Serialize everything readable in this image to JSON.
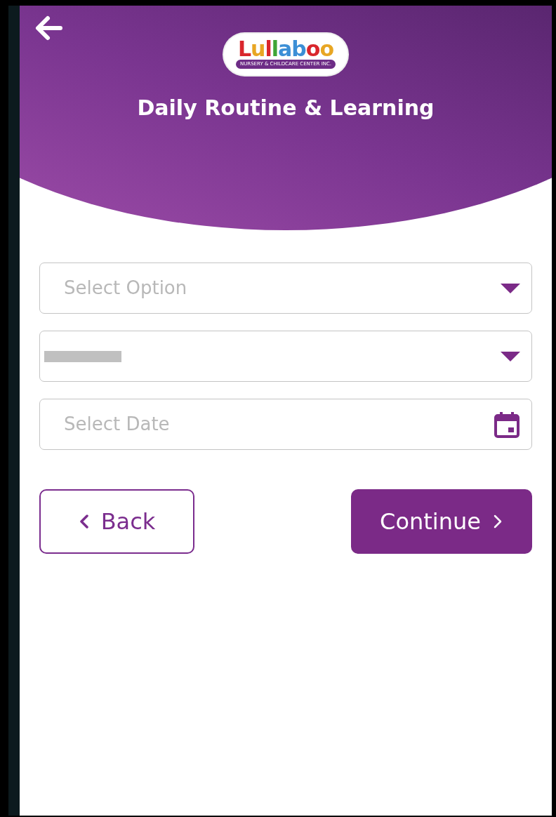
{
  "header": {
    "logo": {
      "name": "Lullaboo",
      "tagline": "NURSERY & CHILDCARE CENTER INC."
    },
    "title": "Daily Routine & Learning"
  },
  "fields": [
    {
      "kind": "dropdown",
      "placeholder": "Select Option"
    },
    {
      "kind": "dropdown",
      "redacted": true
    },
    {
      "kind": "date",
      "placeholder": "Select Date"
    }
  ],
  "buttons": [
    {
      "kind": "back",
      "label": "Back"
    },
    {
      "kind": "continue",
      "label": "Continue"
    }
  ]
}
